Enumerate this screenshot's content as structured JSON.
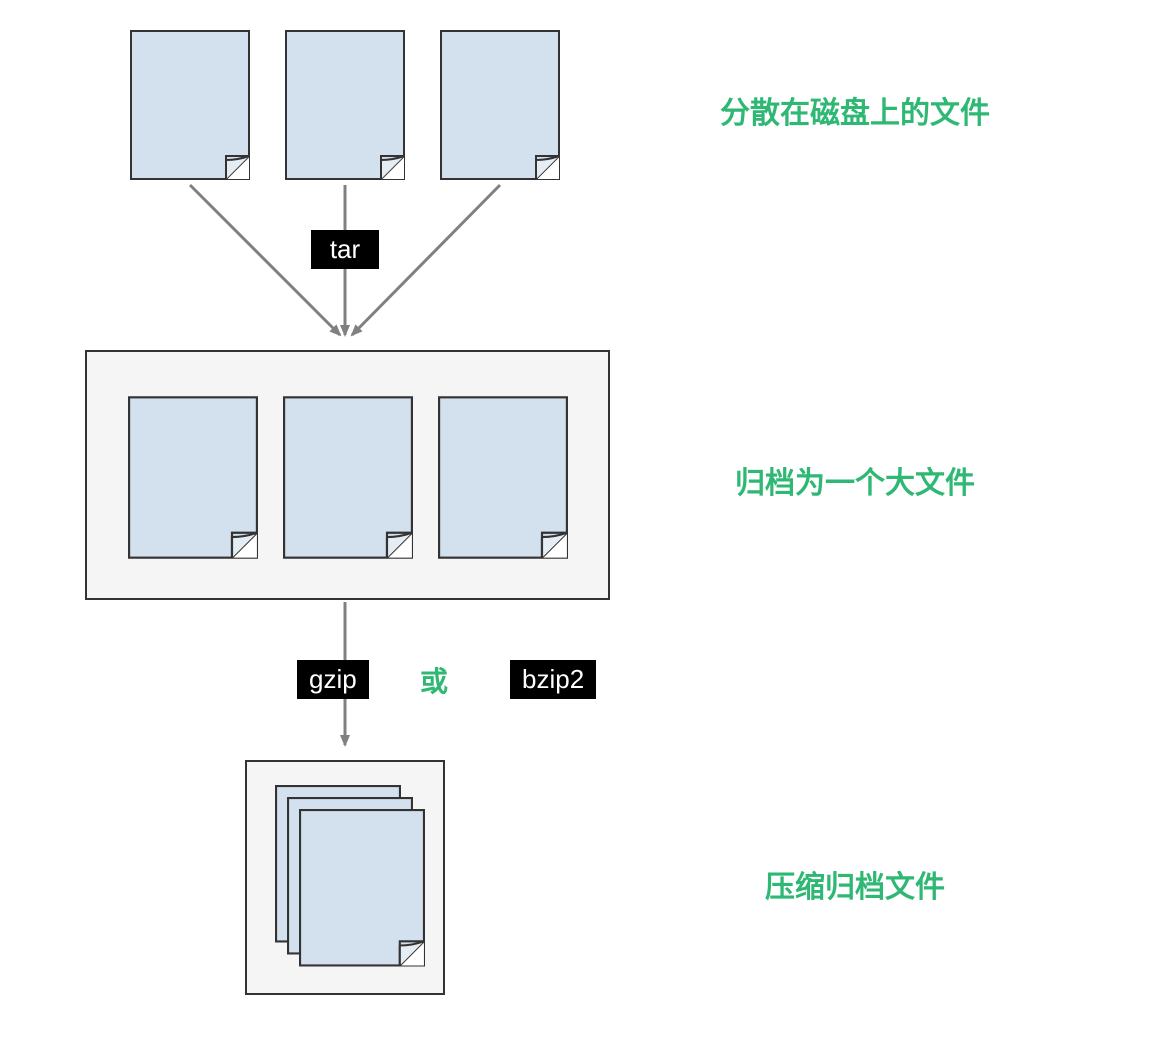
{
  "labels": {
    "scattered": "分散在磁盘上的文件",
    "archived": "归档为一个大文件",
    "compressed": "压缩归档文件",
    "tar": "tar",
    "gzip": "gzip",
    "or": "或",
    "bzip2": "bzip2"
  },
  "colors": {
    "file_fill": "#d3e0ed",
    "file_stroke": "#333333",
    "container_fill": "#f5f5f5",
    "container_stroke": "#333333",
    "badge_bg": "#000000",
    "badge_fg": "#ffffff",
    "label_fg": "#2eb873",
    "arrow": "#808080"
  },
  "diagram": {
    "stage1": {
      "files": 3,
      "description": "three separate file icons"
    },
    "step1_tool": "tar",
    "stage2": {
      "files": 3,
      "grouped": true,
      "description": "three files inside one archive container"
    },
    "step2_tools": [
      "gzip",
      "bzip2"
    ],
    "stage3": {
      "stacked_files": 3,
      "grouped": true,
      "description": "stacked file icons inside small container (compressed archive)"
    }
  }
}
